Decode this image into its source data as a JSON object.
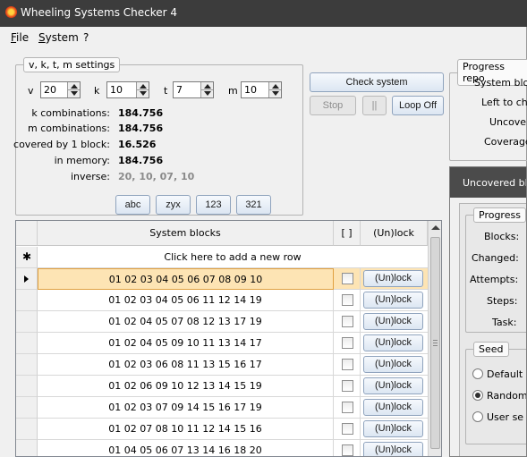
{
  "window": {
    "title": "Wheeling Systems Checker 4"
  },
  "menu": [
    {
      "label": "File",
      "underline": "F",
      "rest": "ile"
    },
    {
      "label": "System",
      "underline": "S",
      "rest": "ystem"
    },
    {
      "label": "?"
    }
  ],
  "settings": {
    "legend": "v, k, t, m settings",
    "v": {
      "label": "v",
      "value": "20"
    },
    "k": {
      "label": "k",
      "value": "10"
    },
    "t": {
      "label": "t",
      "value": "7"
    },
    "m": {
      "label": "m",
      "value": "10"
    },
    "stats": [
      {
        "label": "k combinations:",
        "value": "184.756"
      },
      {
        "label": "m combinations:",
        "value": "184.756"
      },
      {
        "label": "covered by 1 block:",
        "value": "16.526"
      },
      {
        "label": "in memory:",
        "value": "184.756"
      },
      {
        "label": "inverse:",
        "value": "20, 10, 07, 10"
      }
    ]
  },
  "actions": {
    "check": "Check system",
    "stop": "Stop",
    "pause": "||",
    "loop": "Loop Off"
  },
  "sort_buttons": [
    "abc",
    "zyx",
    "123",
    "321"
  ],
  "progress_report": {
    "legend": "Progress repo",
    "labels": [
      "System bloc",
      "Left to che",
      "Uncover",
      "Coverage"
    ]
  },
  "grid": {
    "headers": {
      "blocks": "System blocks",
      "check": "[ ]",
      "lock": "(Un)lock"
    },
    "new_row_text": "Click here to add a new row",
    "lock_label": "(Un)lock",
    "rows": [
      {
        "blocks": "01 02 03 04 05 06 07 08 09 10",
        "checked": false,
        "selected": true
      },
      {
        "blocks": "01 02 03 04 05 06 11 12 14 19",
        "checked": false
      },
      {
        "blocks": "01 02 04 05 07 08 12 13 17 19",
        "checked": false
      },
      {
        "blocks": "01 02 04 05 09 10 11 13 14 17",
        "checked": false
      },
      {
        "blocks": "01 02 03 06 08 11 13 15 16 17",
        "checked": false
      },
      {
        "blocks": "01 02 06 09 10 12 13 14 15 19",
        "checked": false
      },
      {
        "blocks": "01 02 03 07 09 14 15 16 17 19",
        "checked": false
      },
      {
        "blocks": "01 02 07 08 10 11 12 14 15 16",
        "checked": false
      },
      {
        "blocks": "01 04 05 06 07 13 14 16 18 20",
        "checked": false
      }
    ]
  },
  "uncovered_panel": {
    "header": "Uncovered blo",
    "progress_legend": "Progress",
    "progress_labels": [
      "Blocks:",
      "Changed:",
      "Attempts:",
      "Steps:",
      "Task:"
    ],
    "seed_legend": "Seed",
    "seed_options": [
      {
        "label": "Default",
        "selected": false
      },
      {
        "label": "Random",
        "selected": true
      },
      {
        "label": "User se",
        "selected": false
      }
    ]
  }
}
